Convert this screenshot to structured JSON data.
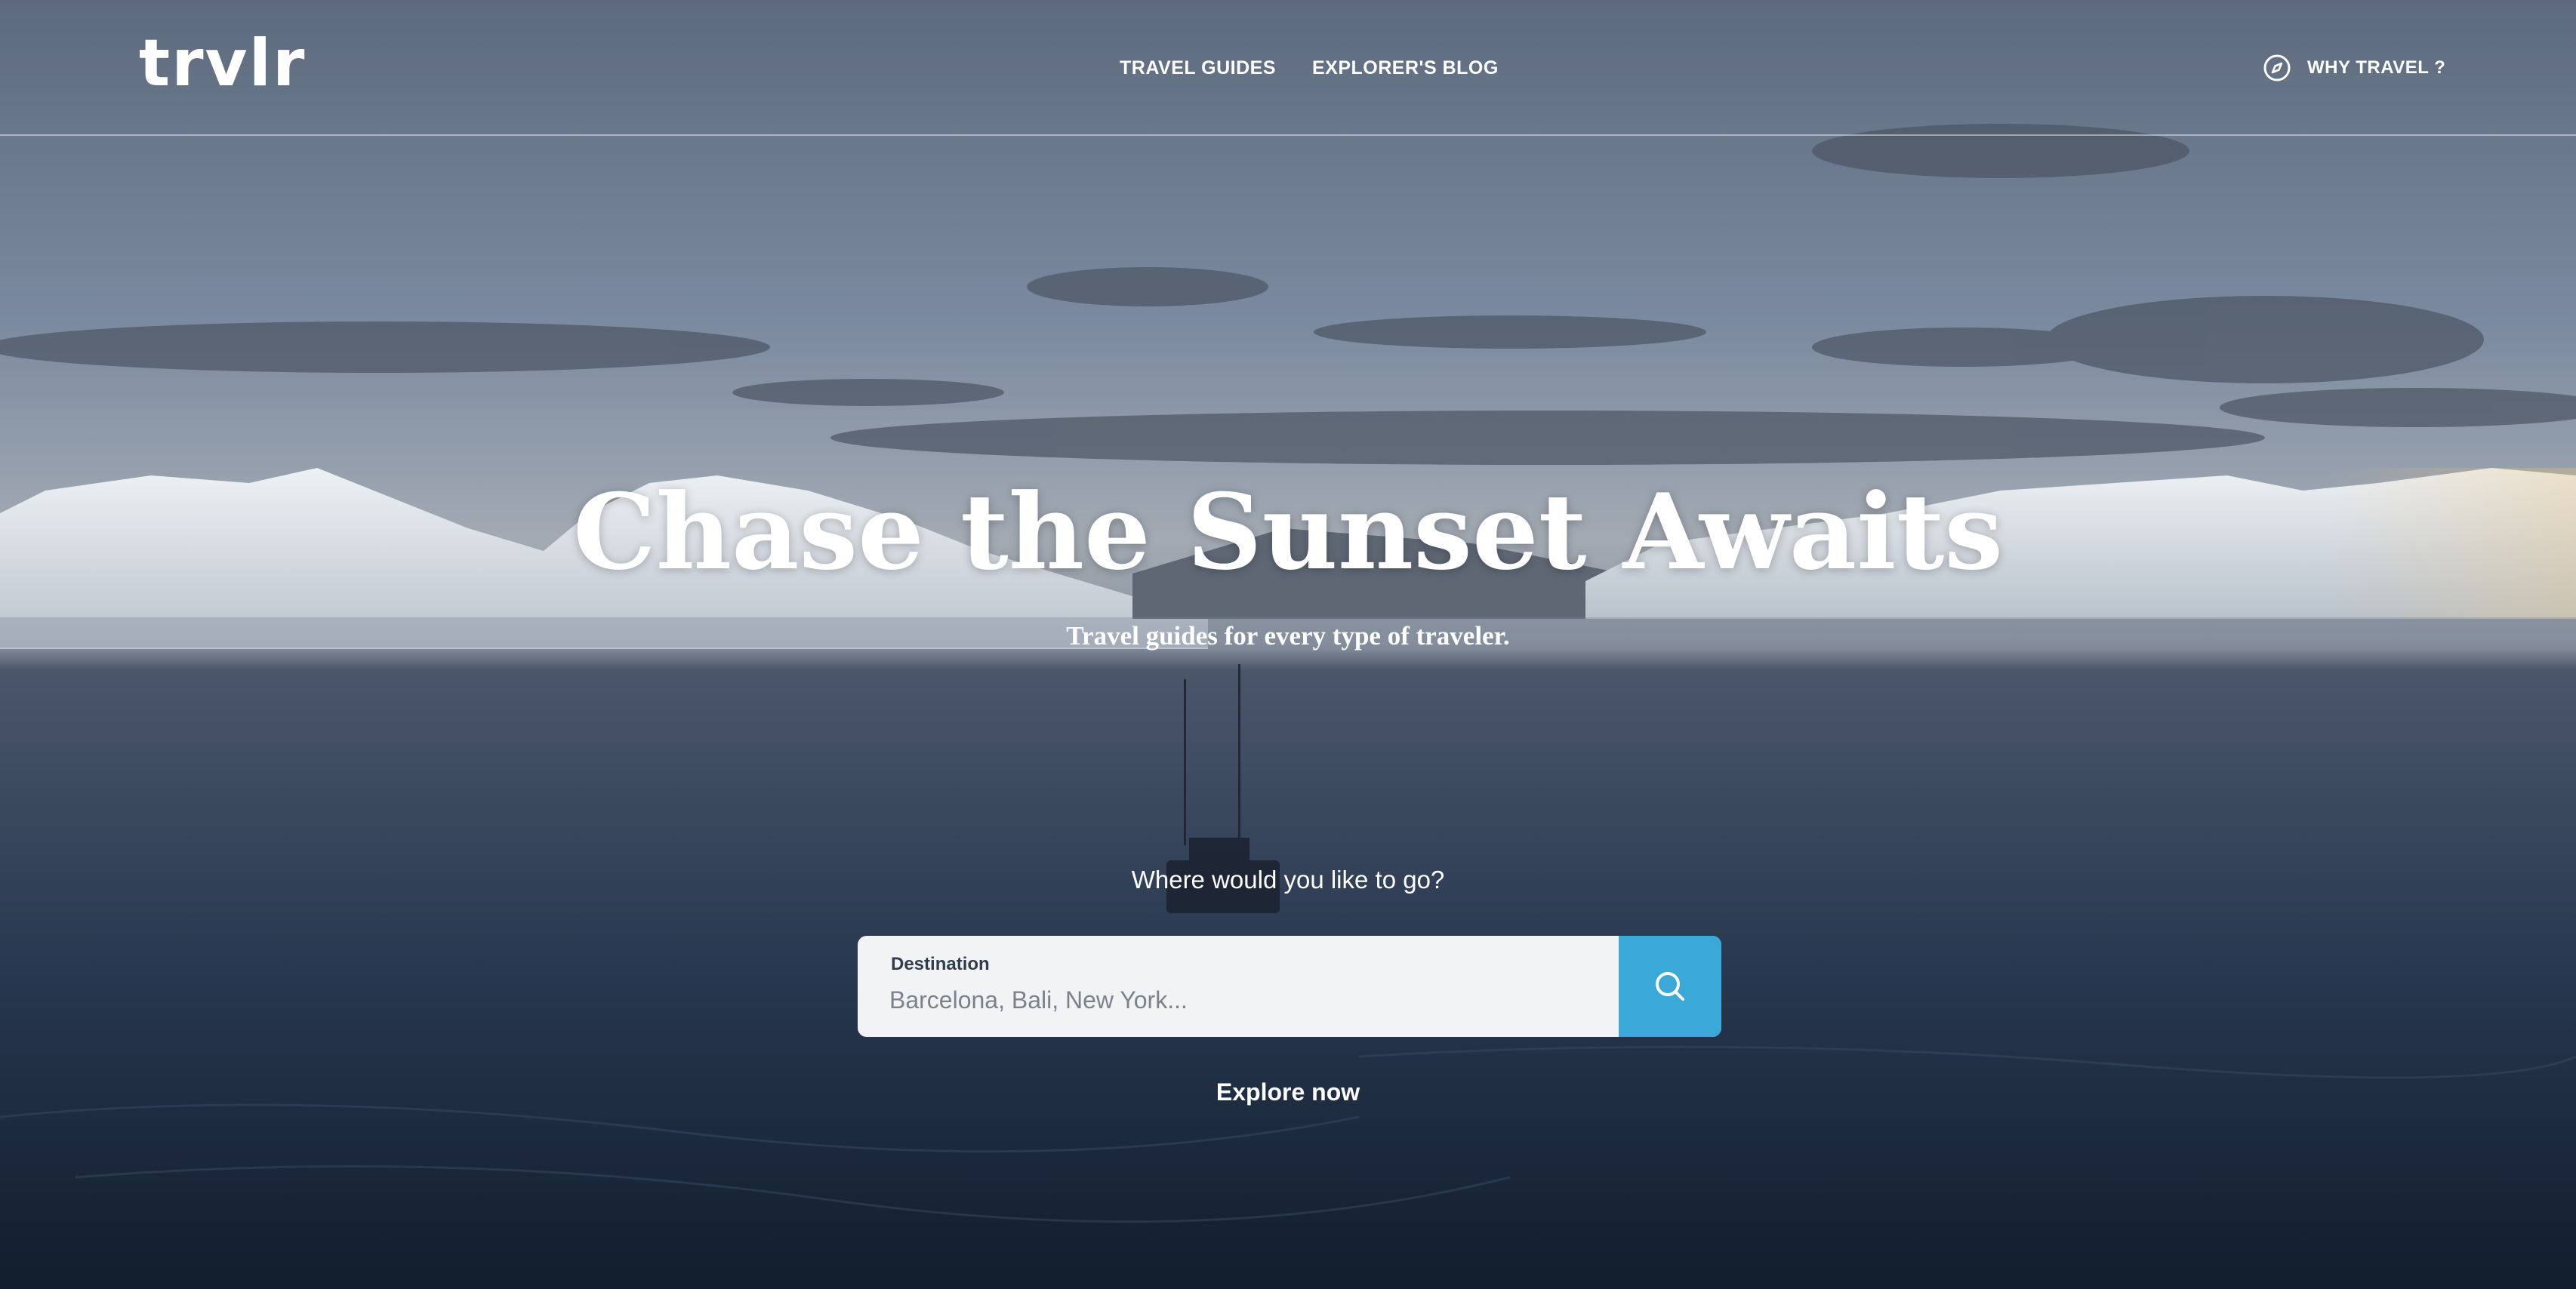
{
  "header": {
    "logo": "trvlr",
    "nav": [
      {
        "label": "TRAVEL GUIDES"
      },
      {
        "label": "EXPLORER'S BLOG"
      }
    ],
    "why_travel": {
      "label": "WHY TRAVEL ?",
      "icon": "compass-icon"
    }
  },
  "hero": {
    "title": "Chase the Sunset  Awaits",
    "subtitle": "Travel guides for every type of traveler."
  },
  "search": {
    "prompt": "Where would you like to go?",
    "label": "Destination",
    "value": "",
    "placeholder": "Barcelona, Bali, New York...",
    "button_icon": "search-icon",
    "button_color": "#3aa9d8"
  },
  "cta": {
    "label": "Explore now"
  }
}
